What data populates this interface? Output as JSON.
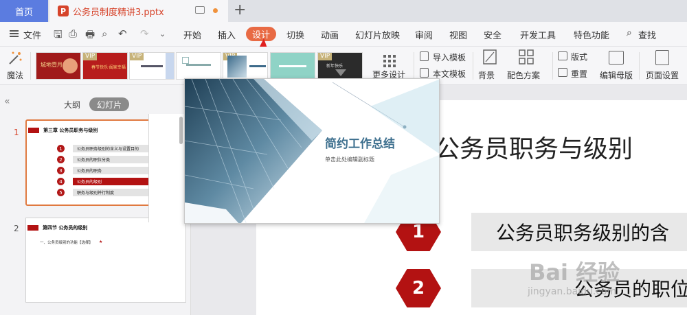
{
  "tabs": {
    "home": "首页",
    "file": "公务员制度精讲3.pptx",
    "new_tab": "+"
  },
  "menu": {
    "file": "文件",
    "items": [
      "开始",
      "插入",
      "设计",
      "切换",
      "动画",
      "幻灯片放映",
      "审阅",
      "视图",
      "安全",
      "开发工具",
      "特色功能"
    ],
    "active": "设计",
    "search": "查找"
  },
  "ribbon": {
    "magic": "魔法",
    "vip": "VIP",
    "more_design": "更多设计",
    "import_template": "导入模板",
    "this_template": "本文模板",
    "background": "背景",
    "color_scheme": "配色方案",
    "layout": "版式",
    "reset": "重置",
    "edit_master": "编辑母版",
    "page_setup": "页面设置",
    "thumb_texts": [
      "城地壹月",
      "春节快乐·阖家幸福",
      "简约工作总结",
      "新年快乐"
    ]
  },
  "left_panel": {
    "outline_tab": "大纲",
    "slides_tab": "幻灯片",
    "slide1": {
      "number": "1",
      "title": "第三章 公务员职务与级别",
      "rows": [
        {
          "n": "1",
          "text": "公务员职务级别的含义与设置目的"
        },
        {
          "n": "2",
          "text": "公务员的职位分类"
        },
        {
          "n": "3",
          "text": "公务员的职务"
        },
        {
          "n": "4",
          "text": "公务员的级别"
        },
        {
          "n": "5",
          "text": "职务与级别并行制度"
        }
      ]
    },
    "slide2": {
      "number": "2",
      "title": "第四节 公务员的级别",
      "line": "一、公务员级别的功能【选择】"
    }
  },
  "popup": {
    "title": "简约工作总结",
    "subtitle": "单击此处编辑副标题"
  },
  "slide": {
    "title": "公务员职务与级别",
    "items": [
      {
        "n": "1",
        "text": "公务员职务级别的含"
      },
      {
        "n": "2",
        "text": "公务员的职位"
      }
    ]
  },
  "watermark": {
    "main": "Bai 经验",
    "url": "jingyan.baidu.com"
  },
  "colors": {
    "accent": "#e86a44",
    "brand_red": "#b31212",
    "home_tab": "#5b7ce0",
    "ppt": "#d6432a"
  }
}
